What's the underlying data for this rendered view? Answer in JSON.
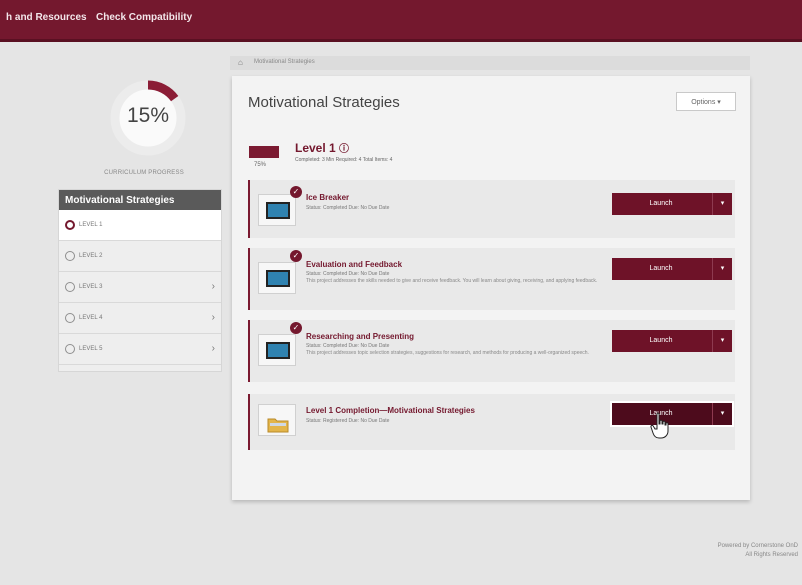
{
  "nav": {
    "item1": "h and Resources",
    "item2": "Check Compatibility"
  },
  "progress": {
    "percent_label": "15%",
    "percent_value": 15,
    "caption": "CURRICULUM PROGRESS"
  },
  "sidebar": {
    "heading": "Motivational Strategies",
    "items": [
      {
        "label": "LEVEL 1",
        "has_chevron": false,
        "active": true
      },
      {
        "label": "LEVEL 2",
        "has_chevron": false,
        "active": false
      },
      {
        "label": "LEVEL 3",
        "has_chevron": true,
        "active": false
      },
      {
        "label": "LEVEL 4",
        "has_chevron": true,
        "active": false
      },
      {
        "label": "LEVEL 5",
        "has_chevron": true,
        "active": false
      }
    ],
    "chevron_glyph": "›"
  },
  "breadcrumb": {
    "home_icon": "home-icon",
    "home_glyph": "⌂",
    "current": "Motivational Strategies"
  },
  "main": {
    "title": "Motivational Strategies",
    "options_label": "Options ▾",
    "level": {
      "title": "Level 1",
      "info_glyph": "ⓘ",
      "percent": "75%",
      "meta": "Completed: 3   Min Required: 4   Total Items: 4"
    },
    "courses": [
      {
        "name": "Ice Breaker",
        "status": "Status: Completed    Due: No Due Date",
        "description": "",
        "completed": true,
        "icon": "monitor-icon",
        "launch_label": "Launch",
        "highlighted": false
      },
      {
        "name": "Evaluation and Feedback",
        "status": "Status: Completed    Due: No Due Date",
        "description": "This project addresses the skills needed to give and receive feedback. You will learn about giving, receiving, and applying feedback.",
        "completed": true,
        "icon": "monitor-icon",
        "launch_label": "Launch",
        "highlighted": false
      },
      {
        "name": "Researching and Presenting",
        "status": "Status: Completed    Due: No Due Date",
        "description": "This project addresses topic selection strategies, suggestions for research, and methods for producing a well-organized speech.",
        "completed": true,
        "icon": "monitor-icon",
        "launch_label": "Launch",
        "highlighted": false
      },
      {
        "name": "Level 1 Completion—Motivational Strategies",
        "status": "Status: Registered    Due: No Due Date",
        "description": "",
        "completed": false,
        "icon": "folder-icon",
        "launch_label": "Launch",
        "highlighted": true
      }
    ],
    "check_glyph": "✓",
    "caret_glyph": "▾"
  },
  "footer": {
    "line1": "Powered by Cornerstone OnD",
    "line2": "All Rights Reserved"
  },
  "colors": {
    "brand": "#74182e",
    "launch": "#6e1228",
    "monitor": "#2f82b0"
  }
}
